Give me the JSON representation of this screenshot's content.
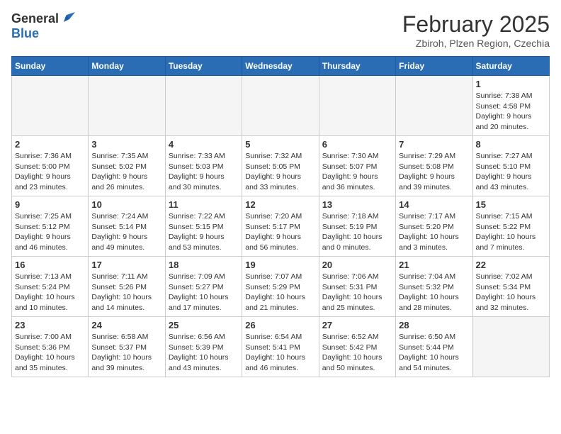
{
  "header": {
    "logo_general": "General",
    "logo_blue": "Blue",
    "month_title": "February 2025",
    "location": "Zbiroh, Plzen Region, Czechia"
  },
  "weekdays": [
    "Sunday",
    "Monday",
    "Tuesday",
    "Wednesday",
    "Thursday",
    "Friday",
    "Saturday"
  ],
  "weeks": [
    [
      {
        "day": "",
        "info": ""
      },
      {
        "day": "",
        "info": ""
      },
      {
        "day": "",
        "info": ""
      },
      {
        "day": "",
        "info": ""
      },
      {
        "day": "",
        "info": ""
      },
      {
        "day": "",
        "info": ""
      },
      {
        "day": "1",
        "info": "Sunrise: 7:38 AM\nSunset: 4:58 PM\nDaylight: 9 hours\nand 20 minutes."
      }
    ],
    [
      {
        "day": "2",
        "info": "Sunrise: 7:36 AM\nSunset: 5:00 PM\nDaylight: 9 hours\nand 23 minutes."
      },
      {
        "day": "3",
        "info": "Sunrise: 7:35 AM\nSunset: 5:02 PM\nDaylight: 9 hours\nand 26 minutes."
      },
      {
        "day": "4",
        "info": "Sunrise: 7:33 AM\nSunset: 5:03 PM\nDaylight: 9 hours\nand 30 minutes."
      },
      {
        "day": "5",
        "info": "Sunrise: 7:32 AM\nSunset: 5:05 PM\nDaylight: 9 hours\nand 33 minutes."
      },
      {
        "day": "6",
        "info": "Sunrise: 7:30 AM\nSunset: 5:07 PM\nDaylight: 9 hours\nand 36 minutes."
      },
      {
        "day": "7",
        "info": "Sunrise: 7:29 AM\nSunset: 5:08 PM\nDaylight: 9 hours\nand 39 minutes."
      },
      {
        "day": "8",
        "info": "Sunrise: 7:27 AM\nSunset: 5:10 PM\nDaylight: 9 hours\nand 43 minutes."
      }
    ],
    [
      {
        "day": "9",
        "info": "Sunrise: 7:25 AM\nSunset: 5:12 PM\nDaylight: 9 hours\nand 46 minutes."
      },
      {
        "day": "10",
        "info": "Sunrise: 7:24 AM\nSunset: 5:14 PM\nDaylight: 9 hours\nand 49 minutes."
      },
      {
        "day": "11",
        "info": "Sunrise: 7:22 AM\nSunset: 5:15 PM\nDaylight: 9 hours\nand 53 minutes."
      },
      {
        "day": "12",
        "info": "Sunrise: 7:20 AM\nSunset: 5:17 PM\nDaylight: 9 hours\nand 56 minutes."
      },
      {
        "day": "13",
        "info": "Sunrise: 7:18 AM\nSunset: 5:19 PM\nDaylight: 10 hours\nand 0 minutes."
      },
      {
        "day": "14",
        "info": "Sunrise: 7:17 AM\nSunset: 5:20 PM\nDaylight: 10 hours\nand 3 minutes."
      },
      {
        "day": "15",
        "info": "Sunrise: 7:15 AM\nSunset: 5:22 PM\nDaylight: 10 hours\nand 7 minutes."
      }
    ],
    [
      {
        "day": "16",
        "info": "Sunrise: 7:13 AM\nSunset: 5:24 PM\nDaylight: 10 hours\nand 10 minutes."
      },
      {
        "day": "17",
        "info": "Sunrise: 7:11 AM\nSunset: 5:26 PM\nDaylight: 10 hours\nand 14 minutes."
      },
      {
        "day": "18",
        "info": "Sunrise: 7:09 AM\nSunset: 5:27 PM\nDaylight: 10 hours\nand 17 minutes."
      },
      {
        "day": "19",
        "info": "Sunrise: 7:07 AM\nSunset: 5:29 PM\nDaylight: 10 hours\nand 21 minutes."
      },
      {
        "day": "20",
        "info": "Sunrise: 7:06 AM\nSunset: 5:31 PM\nDaylight: 10 hours\nand 25 minutes."
      },
      {
        "day": "21",
        "info": "Sunrise: 7:04 AM\nSunset: 5:32 PM\nDaylight: 10 hours\nand 28 minutes."
      },
      {
        "day": "22",
        "info": "Sunrise: 7:02 AM\nSunset: 5:34 PM\nDaylight: 10 hours\nand 32 minutes."
      }
    ],
    [
      {
        "day": "23",
        "info": "Sunrise: 7:00 AM\nSunset: 5:36 PM\nDaylight: 10 hours\nand 35 minutes."
      },
      {
        "day": "24",
        "info": "Sunrise: 6:58 AM\nSunset: 5:37 PM\nDaylight: 10 hours\nand 39 minutes."
      },
      {
        "day": "25",
        "info": "Sunrise: 6:56 AM\nSunset: 5:39 PM\nDaylight: 10 hours\nand 43 minutes."
      },
      {
        "day": "26",
        "info": "Sunrise: 6:54 AM\nSunset: 5:41 PM\nDaylight: 10 hours\nand 46 minutes."
      },
      {
        "day": "27",
        "info": "Sunrise: 6:52 AM\nSunset: 5:42 PM\nDaylight: 10 hours\nand 50 minutes."
      },
      {
        "day": "28",
        "info": "Sunrise: 6:50 AM\nSunset: 5:44 PM\nDaylight: 10 hours\nand 54 minutes."
      },
      {
        "day": "",
        "info": ""
      }
    ]
  ]
}
